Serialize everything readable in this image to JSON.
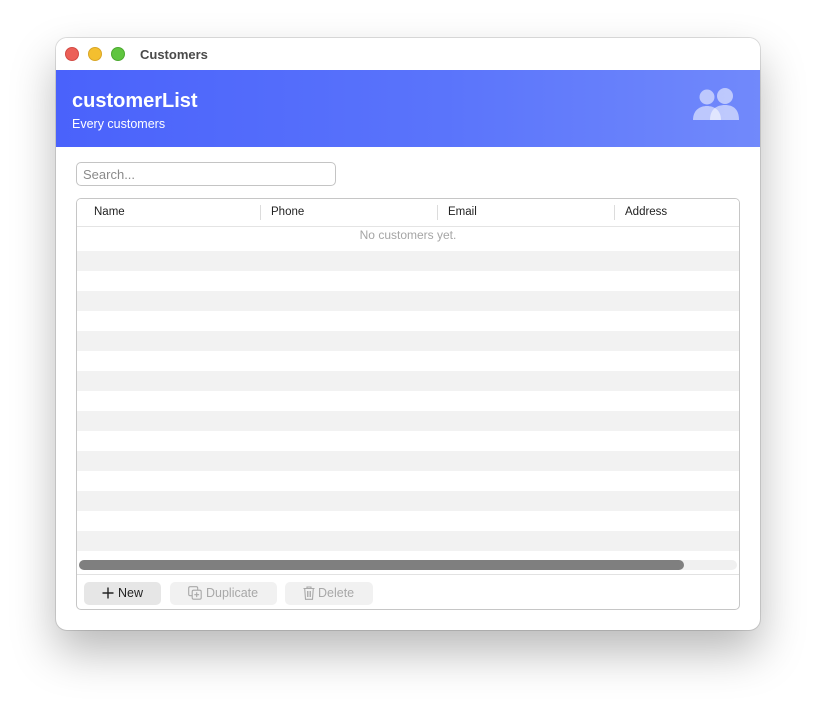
{
  "window": {
    "title": "Customers"
  },
  "banner": {
    "title": "customerList",
    "subtitle": "Every customers",
    "icon": "people-icon",
    "gradient_start": "#4a62fb",
    "gradient_end": "#7189fb"
  },
  "search": {
    "value": "",
    "placeholder": "Search..."
  },
  "table": {
    "columns": [
      "Name",
      "Phone",
      "Email",
      "Address"
    ],
    "empty_message": "No customers yet.",
    "rows": [],
    "horizontal_scroll_visible_fraction": 0.92
  },
  "toolbar": {
    "new_label": "New",
    "new_icon": "plus-icon",
    "duplicate_label": "Duplicate",
    "duplicate_icon": "duplicate-icon",
    "duplicate_enabled": false,
    "delete_label": "Delete",
    "delete_icon": "trash-icon",
    "delete_enabled": false
  },
  "colors": {
    "close": "#ec5f57",
    "minimize": "#f4bf2f",
    "zoom": "#5fc53f"
  }
}
